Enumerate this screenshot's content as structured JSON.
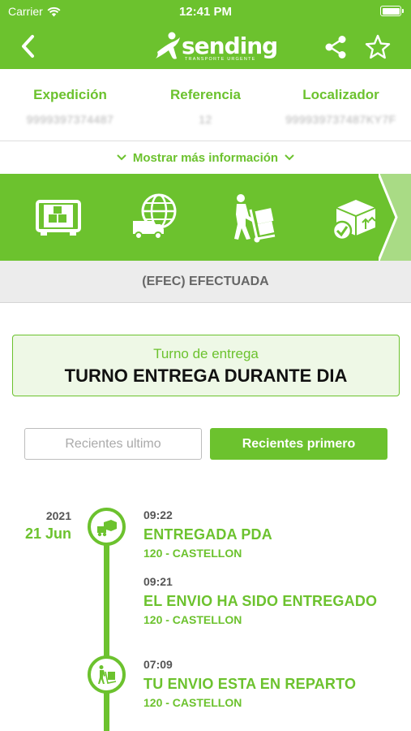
{
  "status_bar": {
    "carrier": "Carrier",
    "time": "12:41 PM"
  },
  "header": {
    "logo_text": "sending",
    "logo_tagline": "TRANSPORTE URGENTE",
    "back_icon": "chevron-left-icon",
    "share_icon": "share-icon",
    "favorite_icon": "star-icon"
  },
  "info": {
    "columns": [
      {
        "label": "Expedición",
        "value": "9999397374487"
      },
      {
        "label": "Referencia",
        "value": "12"
      },
      {
        "label": "Localizador",
        "value": "999939737487KY7F"
      }
    ],
    "more_label": "Mostrar más información"
  },
  "progress_steps": [
    {
      "icon": "package-warehouse-icon"
    },
    {
      "icon": "globe-truck-icon"
    },
    {
      "icon": "delivery-person-icon"
    },
    {
      "icon": "delivered-package-icon"
    }
  ],
  "status": {
    "text": "(EFEC) EFECTUADA"
  },
  "delivery_shift": {
    "title": "Turno de entrega",
    "value": "TURNO ENTREGA DURANTE DIA"
  },
  "sort": {
    "oldest_label": "Recientes ultimo",
    "newest_label": "Recientes primero",
    "selected": "newest"
  },
  "timeline": {
    "date": {
      "year": "2021",
      "day": "21 Jun"
    },
    "events": [
      {
        "time": "09:22",
        "title": "ENTREGADA PDA",
        "place": "120 - CASTELLON"
      },
      {
        "time": "09:21",
        "title": "EL ENVIO HA SIDO ENTREGADO",
        "place": "120 - CASTELLON"
      },
      {
        "time": "07:09",
        "title": "TU ENVIO ESTA EN REPARTO",
        "place": "120 - CASTELLON"
      }
    ]
  },
  "colors": {
    "brand_green": "#6cc22e",
    "status_gray": "#ececec"
  }
}
